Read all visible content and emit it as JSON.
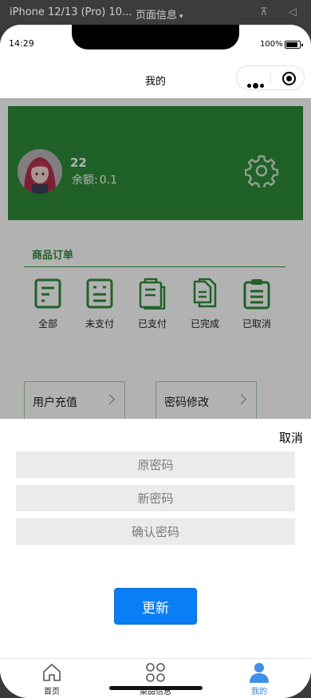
{
  "devtools": {
    "device": "iPhone 12/13 (Pro) 10...",
    "page_info": "页面信息",
    "pin_icon": "pin-icon",
    "volume_icon": "speaker-icon"
  },
  "status_bar": {
    "time": "14:29",
    "battery": "100%"
  },
  "navbar": {
    "title": "我的"
  },
  "profile": {
    "name": "22",
    "balance_label": "余额:",
    "balance_value": "0.1",
    "bg_color": "#2e8b3a"
  },
  "orders": {
    "title": "商品订单",
    "items": [
      {
        "label": "全部",
        "icon": "document-icon"
      },
      {
        "label": "未支付",
        "icon": "unpaid-icon"
      },
      {
        "label": "已支付",
        "icon": "clipboard-icon"
      },
      {
        "label": "已完成",
        "icon": "files-icon"
      },
      {
        "label": "已取消",
        "icon": "list-icon"
      }
    ]
  },
  "menu": {
    "recharge": "用户充值",
    "change_password": "密码修改"
  },
  "sheet": {
    "cancel": "取消",
    "old_password_placeholder": "原密码",
    "new_password_placeholder": "新密码",
    "confirm_password_placeholder": "确认密码",
    "submit": "更新"
  },
  "tabbar": {
    "items": [
      {
        "label": "首页",
        "icon": "home-icon"
      },
      {
        "label": "菜品信息",
        "icon": "grid-icon"
      },
      {
        "label": "我的",
        "icon": "user-icon"
      }
    ],
    "active_color": "#2a82e4"
  }
}
